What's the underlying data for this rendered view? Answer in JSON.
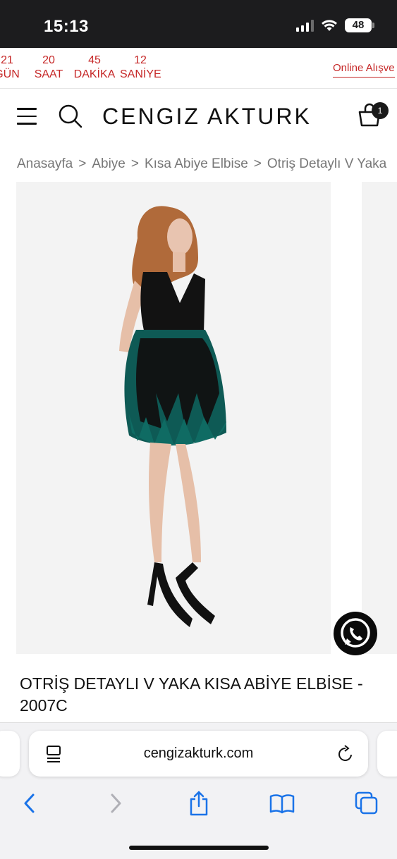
{
  "status_bar": {
    "time": "15:13",
    "battery": "48"
  },
  "countdown": {
    "items": [
      {
        "value": "21",
        "label": "GÜN"
      },
      {
        "value": "20",
        "label": "SAAT"
      },
      {
        "value": "45",
        "label": "DAKİKA"
      },
      {
        "value": "12",
        "label": "SANİYE"
      }
    ],
    "promo": "Online Alışve"
  },
  "header": {
    "logo": "CENGIZ AKTURK",
    "cart_count": "1"
  },
  "breadcrumb": {
    "items": [
      "Anasayfa",
      "Abiye",
      "Kısa Abiye Elbise",
      "Otriş Detaylı V Yaka"
    ],
    "separator": ">"
  },
  "product": {
    "title": "OTRİŞ DETAYLI V YAKA KISA ABİYE ELBİSE - 2007C"
  },
  "browser": {
    "url": "cengizakturk.com"
  },
  "colors": {
    "accent_red": "#c62828",
    "status_bar": "#1c1c1e",
    "ios_blue": "#1a73e8",
    "feather_teal": "#0e5a55"
  },
  "icons": [
    "signal-icon",
    "wifi-icon",
    "battery-icon",
    "menu-icon",
    "search-icon",
    "cart-icon",
    "whatsapp-icon",
    "reader-icon",
    "reload-icon",
    "back-icon",
    "forward-icon",
    "share-icon",
    "bookmarks-icon",
    "tabs-icon"
  ]
}
